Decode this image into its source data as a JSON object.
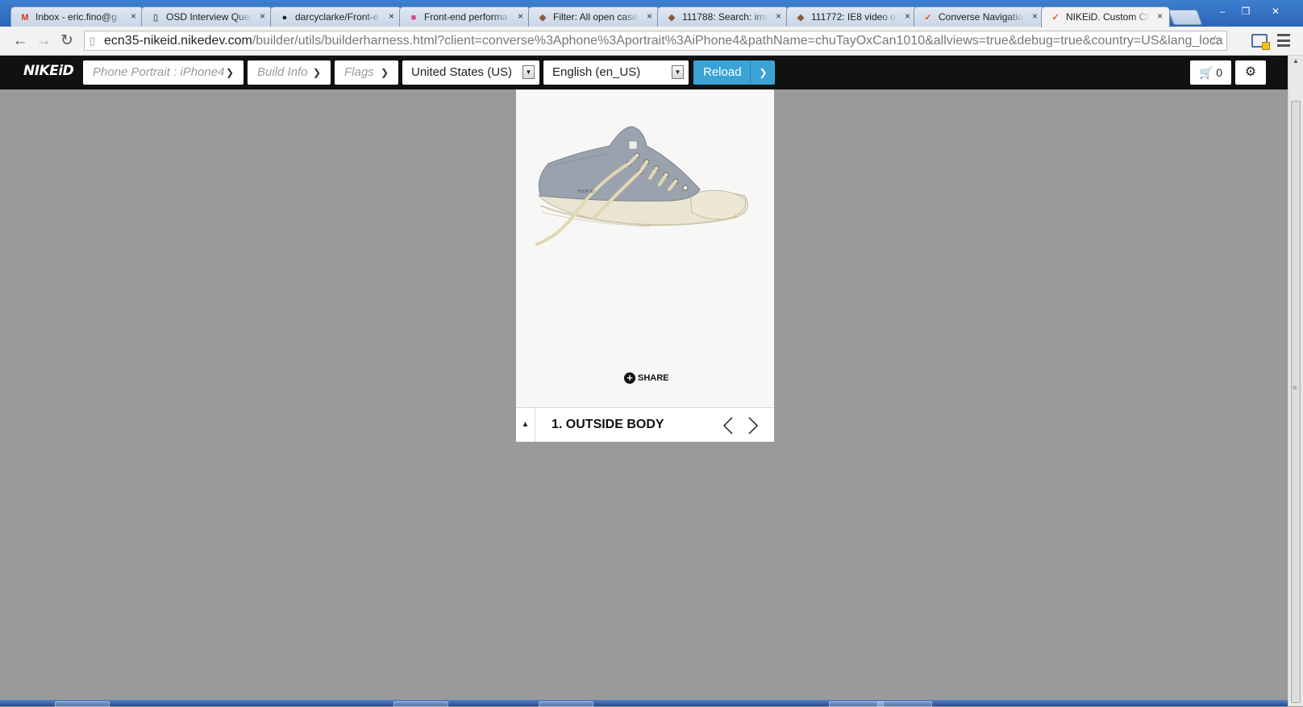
{
  "browser": {
    "tabs": [
      {
        "label": "Inbox - eric.fino@g",
        "icon": "gmail-icon",
        "glyph": "M",
        "color": "#d93025"
      },
      {
        "label": "OSD Interview Ques",
        "icon": "document-icon",
        "glyph": "▯",
        "color": "#666666"
      },
      {
        "label": "darcyclarke/Front-e",
        "icon": "github-icon",
        "glyph": "●",
        "color": "#222222"
      },
      {
        "label": "Front-end performa",
        "icon": "slides-icon",
        "glyph": "■",
        "color": "#d94b8a"
      },
      {
        "label": "Filter: All open case",
        "icon": "bug-tracker-icon",
        "glyph": "◆",
        "color": "#8a5a3c"
      },
      {
        "label": "111788: Search: ima",
        "icon": "bug-tracker-icon",
        "glyph": "◆",
        "color": "#8a5a3c"
      },
      {
        "label": "111772: IE8 video ov",
        "icon": "bug-tracker-icon",
        "glyph": "◆",
        "color": "#8a5a3c"
      },
      {
        "label": "Converse Navigatio",
        "icon": "swoosh-icon",
        "glyph": "✓",
        "color": "#e8501e"
      },
      {
        "label": "NIKEiD. Custom Ch",
        "icon": "swoosh-icon",
        "glyph": "✓",
        "color": "#e8501e"
      }
    ],
    "close_glyph": "×",
    "window_buttons": [
      "–",
      "❐",
      "✕"
    ],
    "url_host": "ecn35-nikeid.nikedev.com",
    "url_path": "/builder/utils/builderharness.html?client=converse%3Aphone%3Aportrait%3AiPhone4&pathName=chuTayOxCan1010&allviews=true&debug=true&country=US&lang_loca"
  },
  "harness": {
    "logo": "NIKEiD",
    "device_label": "Phone Portrait : iPhone4",
    "build_info_label": "Build Info",
    "flags_label": "Flags",
    "country_value": "United States (US)",
    "language_value": "English (en_US)",
    "reload_label": "Reload",
    "cart_count": "0",
    "accent_color": "#3aa3d6"
  },
  "builder": {
    "share_label": "SHARE",
    "step_title": "1. OUTSIDE BODY",
    "shoe_brand_text": "YOUR iD"
  }
}
